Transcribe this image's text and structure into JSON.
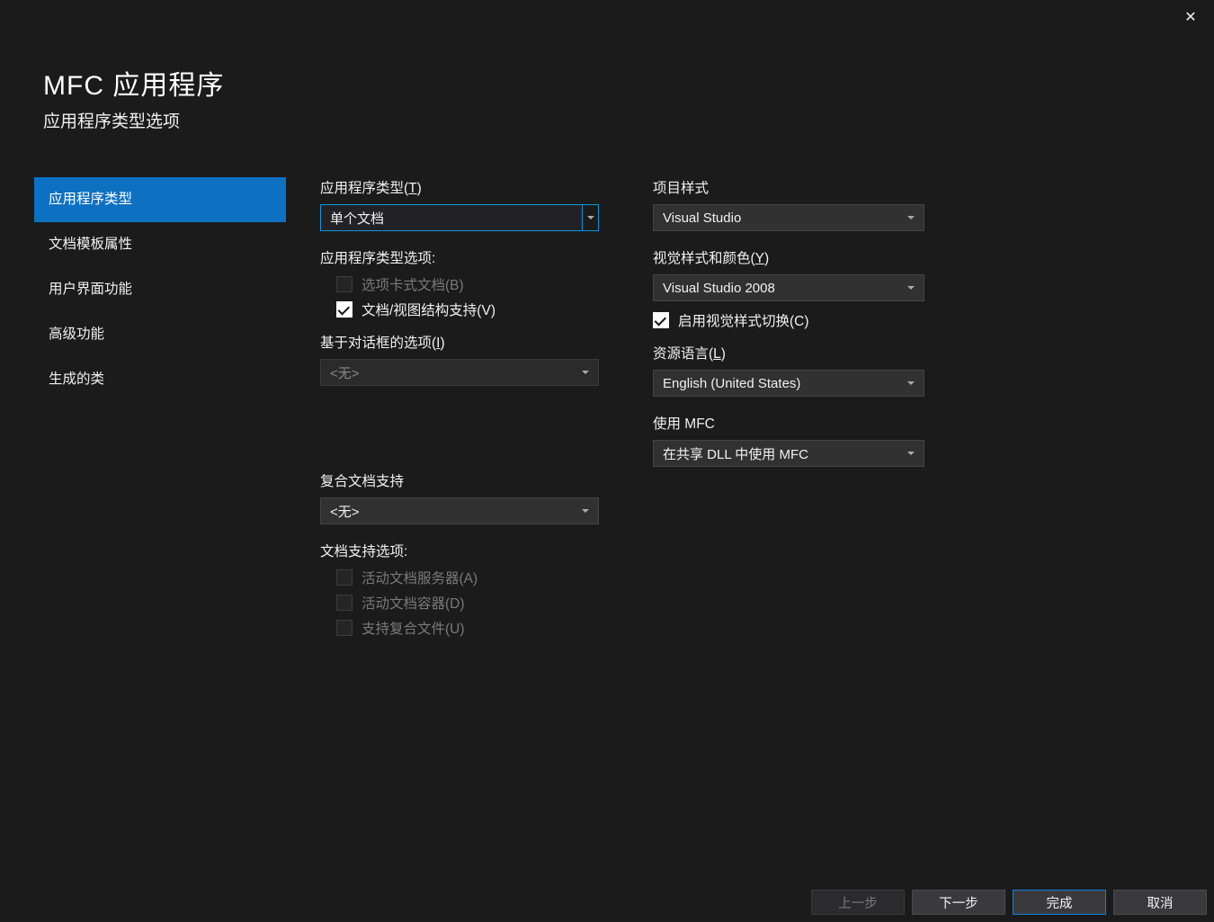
{
  "header": {
    "title": "MFC 应用程序",
    "subtitle": "应用程序类型选项"
  },
  "sidebar": {
    "items": [
      {
        "label": "应用程序类型",
        "active": true
      },
      {
        "label": "文档模板属性"
      },
      {
        "label": "用户界面功能"
      },
      {
        "label": "高级功能"
      },
      {
        "label": "生成的类"
      }
    ]
  },
  "left": {
    "appType": {
      "label_pre": "应用程序类型(",
      "label_ul": "T",
      "label_post": ")",
      "value": "单个文档"
    },
    "optionsLabel": "应用程序类型选项:",
    "tabbed": {
      "label_pre": "选项卡式文档(",
      "label_ul": "B",
      "label_post": ")",
      "checked": false,
      "disabled": true
    },
    "docview": {
      "label_pre": "文档/视图结构支持(",
      "label_ul": "V",
      "label_post": ")",
      "checked": true
    },
    "dialogOpt": {
      "label_pre": "基于对话框的选项(",
      "label_ul": "I",
      "label_post": ")",
      "value": "<无>",
      "disabled": true
    },
    "compound": {
      "label": "复合文档支持",
      "value": "<无>"
    },
    "docSupportLabel": "文档支持选项:",
    "activeServer": {
      "label_pre": "活动文档服务器(",
      "label_ul": "A",
      "label_post": ")",
      "disabled": true
    },
    "activeContainer": {
      "label_pre": "活动文档容器(",
      "label_ul": "D",
      "label_post": ")",
      "disabled": true
    },
    "compoundFiles": {
      "label_pre": "支持复合文件(",
      "label_ul": "U",
      "label_post": ")",
      "disabled": true
    }
  },
  "right": {
    "projectStyle": {
      "label": "项目样式",
      "value": "Visual Studio"
    },
    "visualStyle": {
      "label_pre": "视觉样式和颜色(",
      "label_ul": "Y",
      "label_post": ")",
      "value": "Visual Studio 2008"
    },
    "enableSwitch": {
      "label_pre": "启用视觉样式切换(",
      "label_ul": "C",
      "label_post": ")",
      "checked": true
    },
    "resLang": {
      "label_pre": "资源语言(",
      "label_ul": "L",
      "label_post": ")",
      "value": "English (United States)"
    },
    "useMfc": {
      "label": "使用 MFC",
      "value": "在共享 DLL 中使用 MFC"
    }
  },
  "footer": {
    "prev": "上一步",
    "next": "下一步",
    "finish": "完成",
    "cancel": "取消"
  }
}
